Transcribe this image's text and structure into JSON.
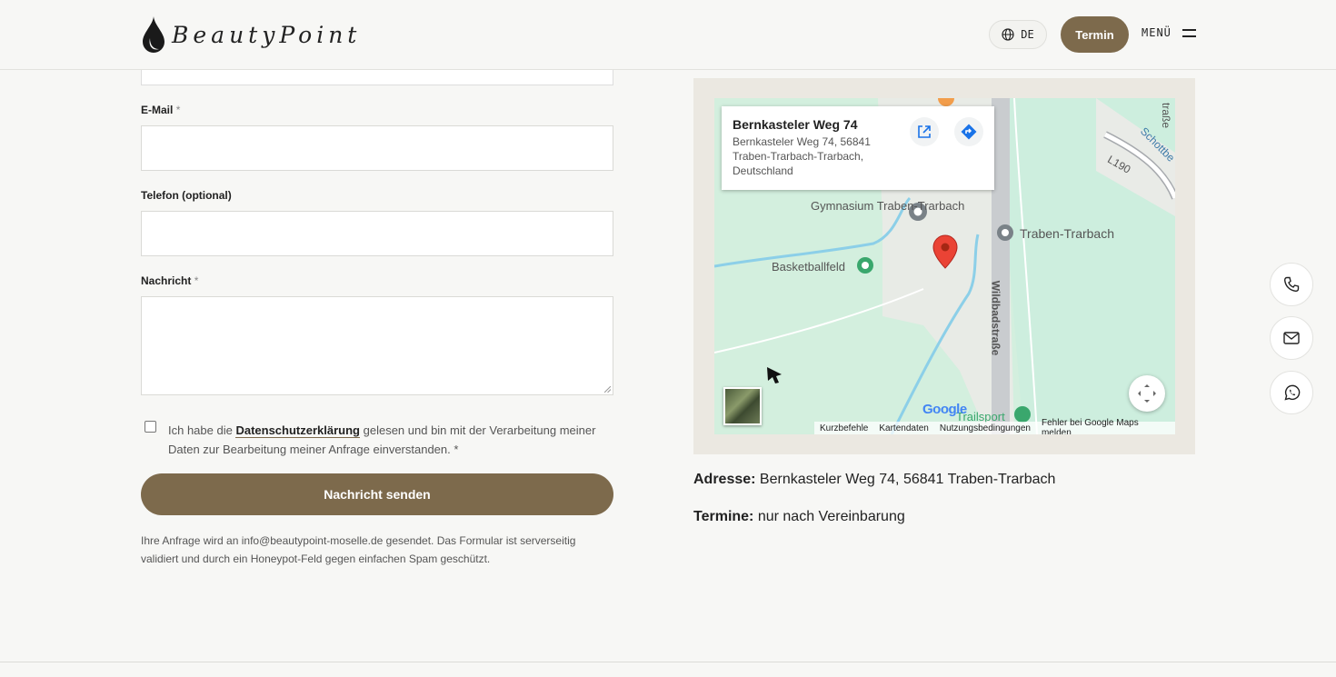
{
  "header": {
    "logo_text": "BeautyPoint",
    "language": "DE",
    "termin_label": "Termin",
    "menu_label": "MENÜ"
  },
  "form": {
    "email_label": "E-Mail",
    "phone_label": "Telefon (optional)",
    "message_label": "Nachricht",
    "required_marker": "*",
    "consent_prefix": "Ich habe die ",
    "consent_link": "Datenschutzerklärung",
    "consent_suffix": " gelesen und bin mit der Verarbeitung meiner Daten zur Bearbeitung meiner Anfrage einverstanden. *",
    "submit_label": "Nachricht senden",
    "note": "Ihre Anfrage wird an info@beautypoint-moselle.de gesendet. Das Formular ist serverseitig validiert und durch ein Honeypot-Feld gegen einfachen Spam geschützt."
  },
  "map": {
    "place_title": "Bernkasteler Weg 74",
    "place_address": "Bernkasteler Weg 74, 56841 Traben-Trarbach-Trarbach, Deutschland",
    "labels": {
      "gymnasium": "Gymnasium Traben-Trarbach",
      "basketball": "Basketballfeld",
      "town": "Traben-Trarbach",
      "street": "Wildbadstraße",
      "road": "L190",
      "trailsport": "Trailsport",
      "strasse_top": "traße",
      "schott": "Schottbe"
    },
    "google": "Google",
    "footer": [
      "Kurzbefehle",
      "Kartendaten",
      "Nutzungsbedingungen",
      "Fehler bei Google Maps melden"
    ]
  },
  "info": {
    "address_label": "Adresse:",
    "address_value": " Bernkasteler Weg 74, 56841 Traben-Trarbach",
    "termine_label": "Termine:",
    "termine_value": " nur nach Vereinbarung"
  },
  "colors": {
    "brand": "#7d6a4c",
    "background": "#f7f7f5"
  },
  "icons": [
    "drop-icon",
    "globe-icon",
    "menu-icon",
    "external-link-icon",
    "directions-icon",
    "fullscreen-icon",
    "phone-icon",
    "mail-icon",
    "whatsapp-icon",
    "location-pin-icon"
  ]
}
